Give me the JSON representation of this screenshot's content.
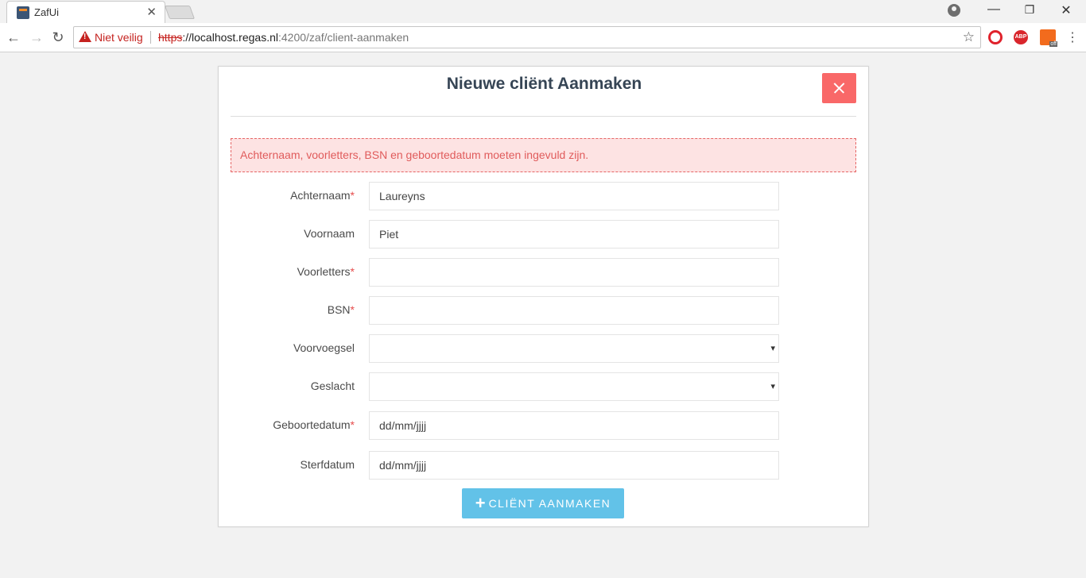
{
  "browser": {
    "tab_title": "ZafUi",
    "tab_close": "✕",
    "security_label": "Niet veilig",
    "url_scheme": "https",
    "url_host": "://localhost.regas.nl",
    "url_path": ":4200/zaf/client-aanmaken",
    "back_glyph": "←",
    "forward_glyph": "→",
    "reload_glyph": "↻",
    "star_glyph": "☆",
    "menu_glyph": "⋮",
    "minimize_glyph": "—",
    "restore_glyph": "❐",
    "close_glyph": "✕",
    "ext_abp_label": "ABP",
    "ext_off_label": "off"
  },
  "modal": {
    "title": "Nieuwe cliënt Aanmaken",
    "close_icon": "close-icon",
    "alert": "Achternaam, voorletters, BSN en geboortedatum moeten ingevuld zijn.",
    "required_mark": "*",
    "fields": {
      "achternaam": {
        "label": "Achternaam",
        "value": "Laureyns"
      },
      "voornaam": {
        "label": "Voornaam",
        "value": "Piet"
      },
      "voorletters": {
        "label": "Voorletters",
        "value": ""
      },
      "bsn": {
        "label": "BSN",
        "value": ""
      },
      "voorvoegsel": {
        "label": "Voorvoegsel",
        "value": ""
      },
      "geslacht": {
        "label": "Geslacht",
        "value": ""
      },
      "geboortedatum": {
        "label": "Geboortedatum",
        "value": "dd/mm/jjjj"
      },
      "sterfdatum": {
        "label": "Sterfdatum",
        "value": "dd/mm/jjjj"
      }
    },
    "submit_icon": "plus-icon",
    "submit_plus": "+",
    "submit_label": "Cliënt aanmaken"
  },
  "colors": {
    "accent": "#62c2e8",
    "danger": "#f96868",
    "alert_bg": "#fde3e3",
    "alert_text": "#e05b5b",
    "title": "#364555"
  }
}
